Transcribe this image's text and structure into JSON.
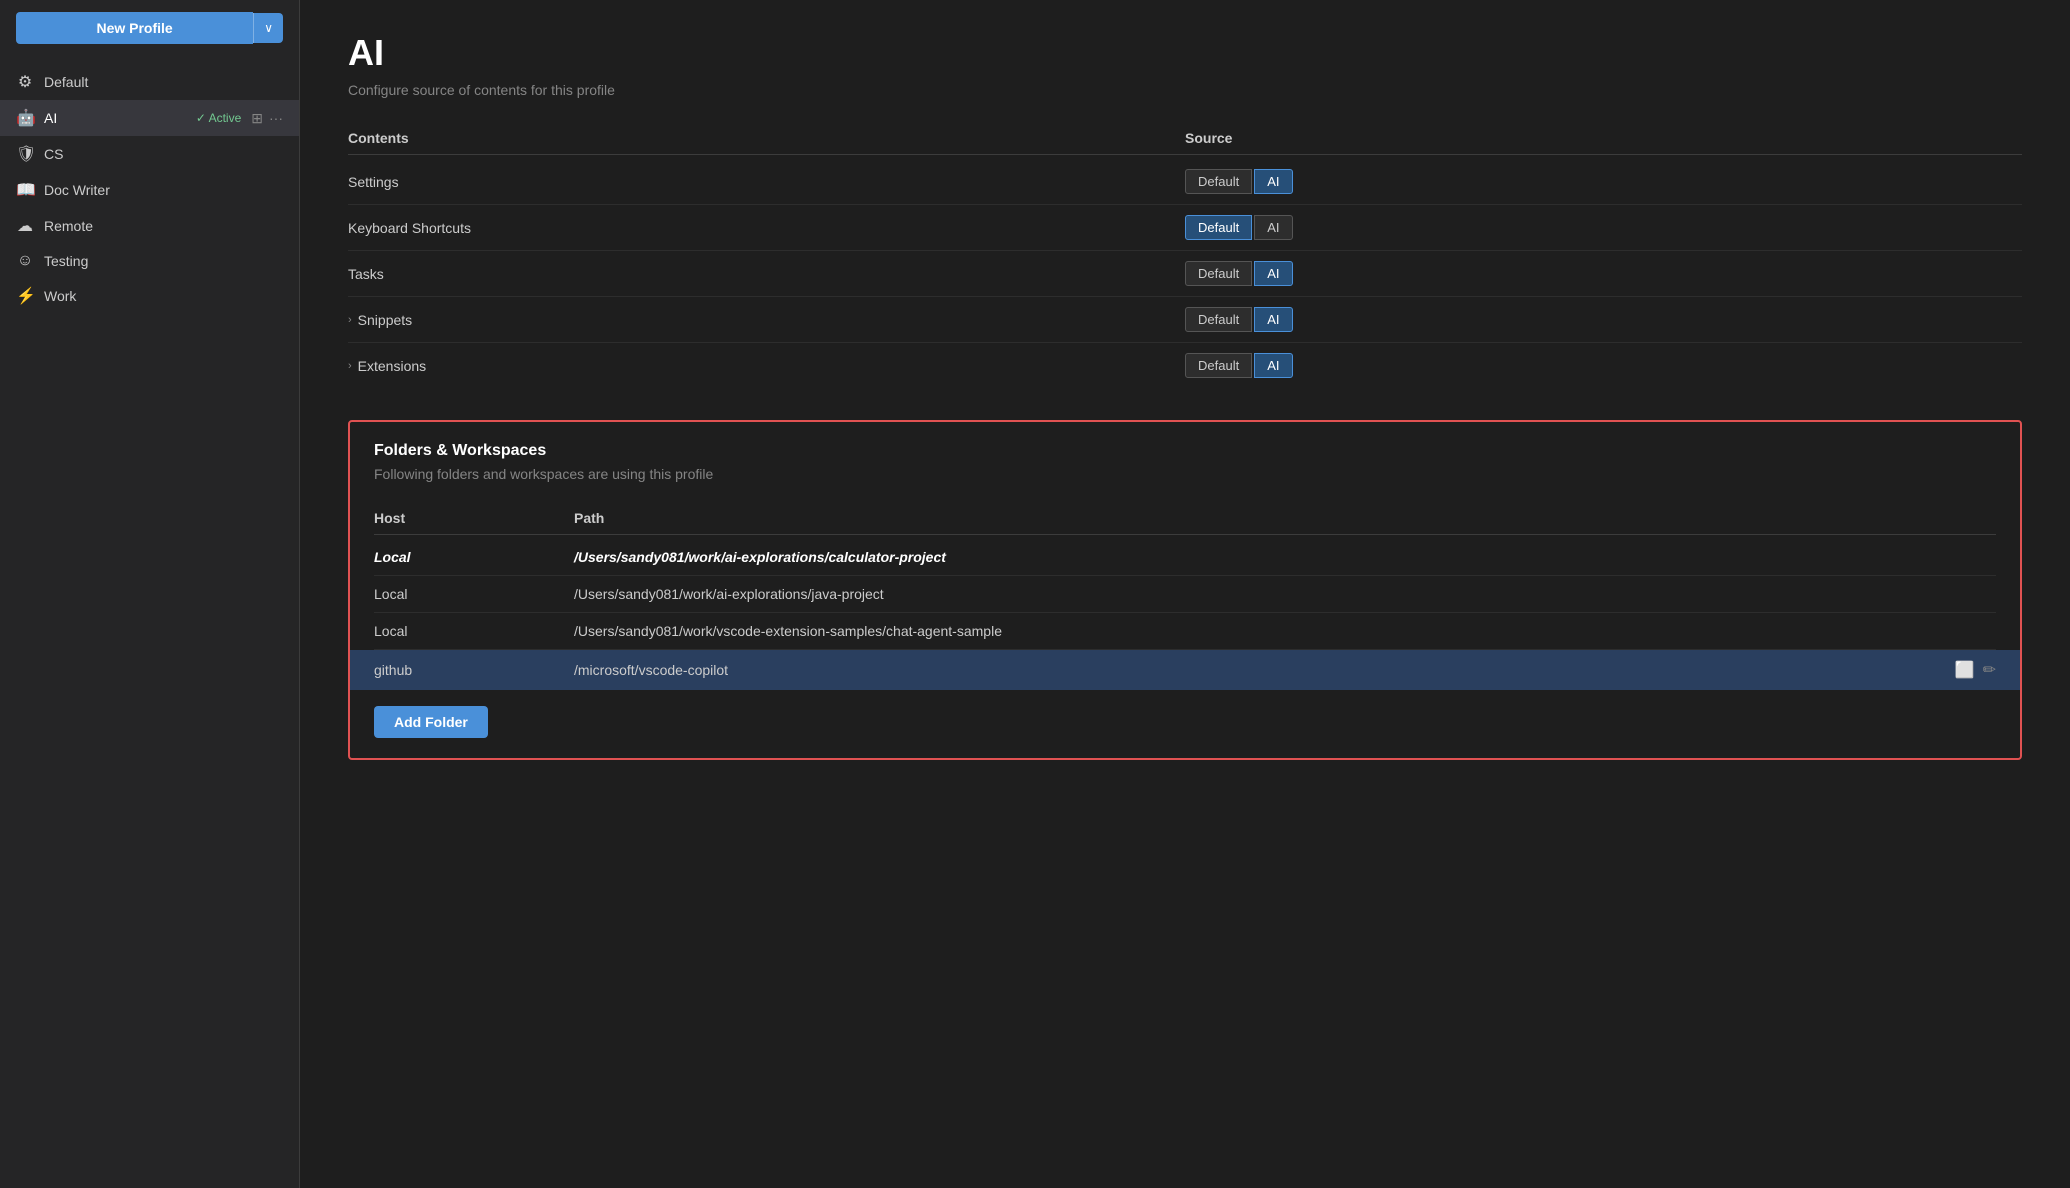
{
  "sidebar": {
    "new_profile_label": "New Profile",
    "chevron": "∨",
    "items": [
      {
        "id": "default",
        "label": "Default",
        "icon": "⚙",
        "active": false,
        "badge": null
      },
      {
        "id": "ai",
        "label": "AI",
        "icon": "🤖",
        "active": true,
        "badge": "✓ Active",
        "hasActions": true
      },
      {
        "id": "cs",
        "label": "CS",
        "icon": "🛡",
        "active": false,
        "badge": null
      },
      {
        "id": "doc-writer",
        "label": "Doc Writer",
        "icon": "📖",
        "active": false,
        "badge": null
      },
      {
        "id": "remote",
        "label": "Remote",
        "icon": "☁",
        "active": false,
        "badge": null
      },
      {
        "id": "testing",
        "label": "Testing",
        "icon": "☺",
        "active": false,
        "badge": null
      },
      {
        "id": "work",
        "label": "Work",
        "icon": "⚡",
        "active": false,
        "badge": null
      }
    ]
  },
  "main": {
    "title": "AI",
    "subtitle": "Configure source of contents for this profile",
    "contents_table": {
      "headers": [
        "Contents",
        "Source"
      ],
      "rows": [
        {
          "label": "Settings",
          "expandable": false,
          "source_default_active": false,
          "source_ai_active": true
        },
        {
          "label": "Keyboard Shortcuts",
          "expandable": false,
          "source_default_active": true,
          "source_ai_active": false
        },
        {
          "label": "Tasks",
          "expandable": false,
          "source_default_active": false,
          "source_ai_active": true
        },
        {
          "label": "Snippets",
          "expandable": true,
          "source_default_active": false,
          "source_ai_active": true
        },
        {
          "label": "Extensions",
          "expandable": true,
          "source_default_active": false,
          "source_ai_active": true
        }
      ],
      "btn_default": "Default",
      "btn_ai": "AI"
    },
    "folders_section": {
      "title": "Folders & Workspaces",
      "subtitle": "Following folders and workspaces are using this profile",
      "table_headers": [
        "Host",
        "Path"
      ],
      "rows": [
        {
          "host": "Local",
          "path": "/Users/sandy081/work/ai-explorations/calculator-project",
          "bold": true,
          "highlighted": false,
          "actions": false
        },
        {
          "host": "Local",
          "path": "/Users/sandy081/work/ai-explorations/java-project",
          "bold": false,
          "highlighted": false,
          "actions": false
        },
        {
          "host": "Local",
          "path": "/Users/sandy081/work/vscode-extension-samples/chat-agent-sample",
          "bold": false,
          "highlighted": false,
          "actions": false
        },
        {
          "host": "github",
          "path": "/microsoft/vscode-copilot",
          "bold": false,
          "highlighted": true,
          "actions": true
        }
      ],
      "add_folder_label": "Add Folder",
      "window_icon": "⬜",
      "edit_icon": "✏"
    }
  }
}
